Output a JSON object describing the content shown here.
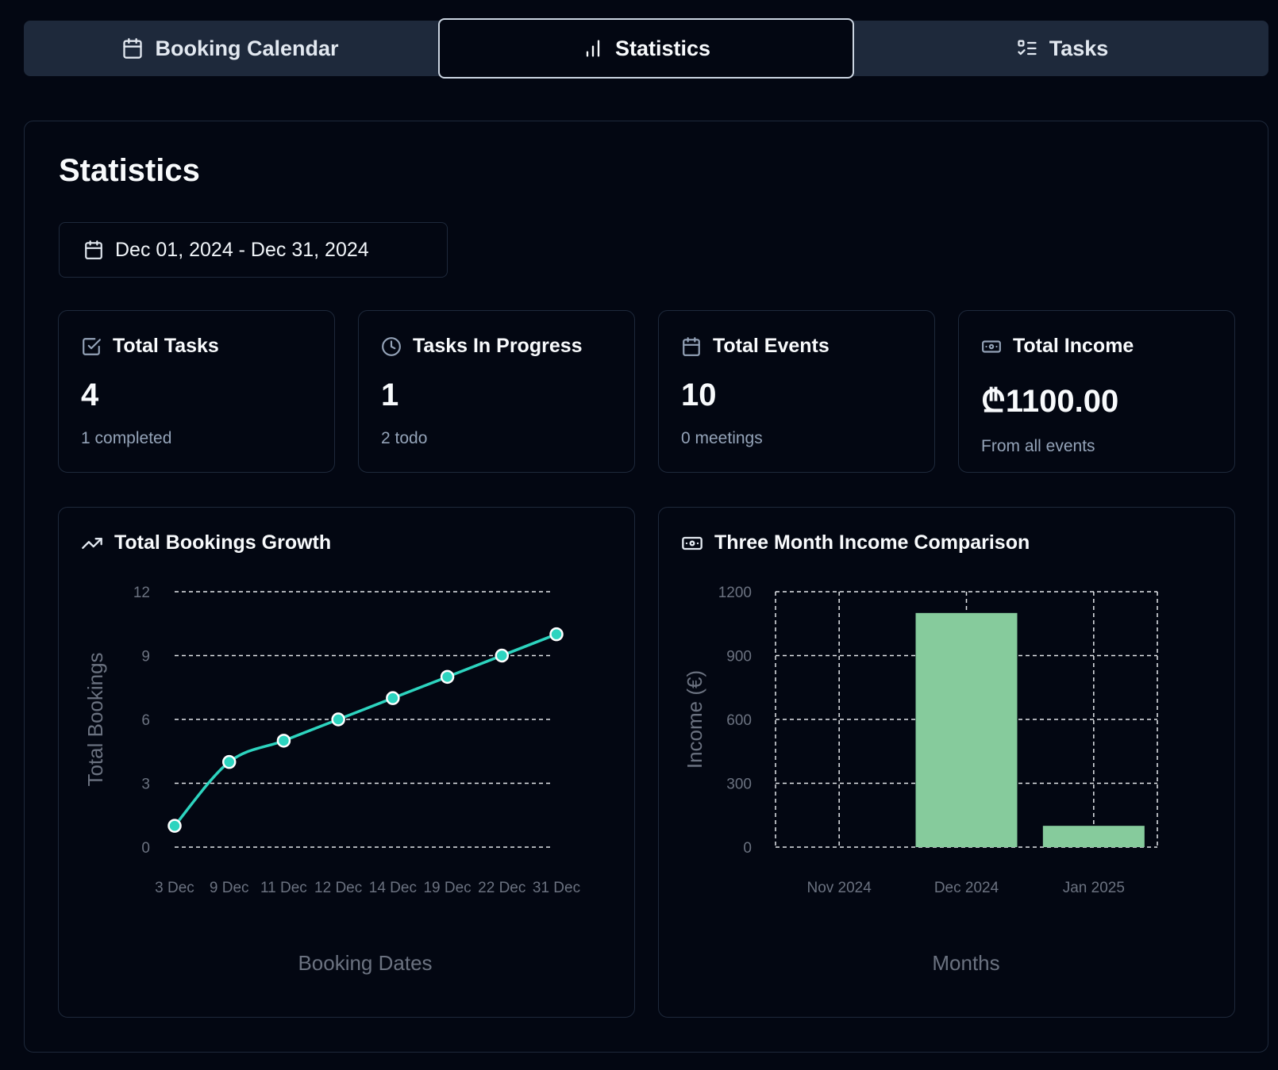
{
  "tabs": [
    {
      "label": "Booking Calendar",
      "icon": "calendar-icon",
      "active": false
    },
    {
      "label": "Statistics",
      "icon": "bar-chart-icon",
      "active": true
    },
    {
      "label": "Tasks",
      "icon": "list-checks-icon",
      "active": false
    }
  ],
  "page": {
    "title": "Statistics",
    "date_range": "Dec 01, 2024 - Dec 31, 2024"
  },
  "cards": [
    {
      "title": "Total Tasks",
      "icon": "check-square-icon",
      "value": "4",
      "sub": "1 completed"
    },
    {
      "title": "Tasks In Progress",
      "icon": "clock-icon",
      "value": "1",
      "sub": "2 todo"
    },
    {
      "title": "Total Events",
      "icon": "calendar-icon",
      "value": "10",
      "sub": "0 meetings"
    },
    {
      "title": "Total Income",
      "icon": "banknote-icon",
      "value": "₾1100.00",
      "sub": "From all events"
    }
  ],
  "colors": {
    "line": "#2dd4bf",
    "bar": "#86cb9c",
    "grid": "#e5e7eb",
    "axis_text": "#6b7280"
  },
  "chart_data": [
    {
      "type": "line",
      "title": "Total Bookings Growth",
      "icon": "trending-up-icon",
      "categories": [
        "3 Dec",
        "9 Dec",
        "11 Dec",
        "12 Dec",
        "14 Dec",
        "19 Dec",
        "22 Dec",
        "31 Dec"
      ],
      "series": [
        {
          "values": [
            1,
            4,
            5,
            6,
            7,
            8,
            9,
            10
          ]
        }
      ],
      "xlabel": "Booking Dates",
      "ylabel": "Total Bookings",
      "yticks": [
        0,
        3,
        6,
        9,
        12
      ],
      "ylim": [
        0,
        12
      ],
      "grid": "horizontal-dashed"
    },
    {
      "type": "bar",
      "title": "Three Month Income Comparison",
      "icon": "banknote-icon",
      "categories": [
        "Nov 2024",
        "Dec 2024",
        "Jan 2025"
      ],
      "series": [
        {
          "values": [
            0,
            1100,
            100
          ]
        }
      ],
      "xlabel": "Months",
      "ylabel": "Income (€)",
      "yticks": [
        0,
        300,
        600,
        900,
        1200
      ],
      "ylim": [
        0,
        1200
      ],
      "grid": "both-dashed"
    }
  ]
}
